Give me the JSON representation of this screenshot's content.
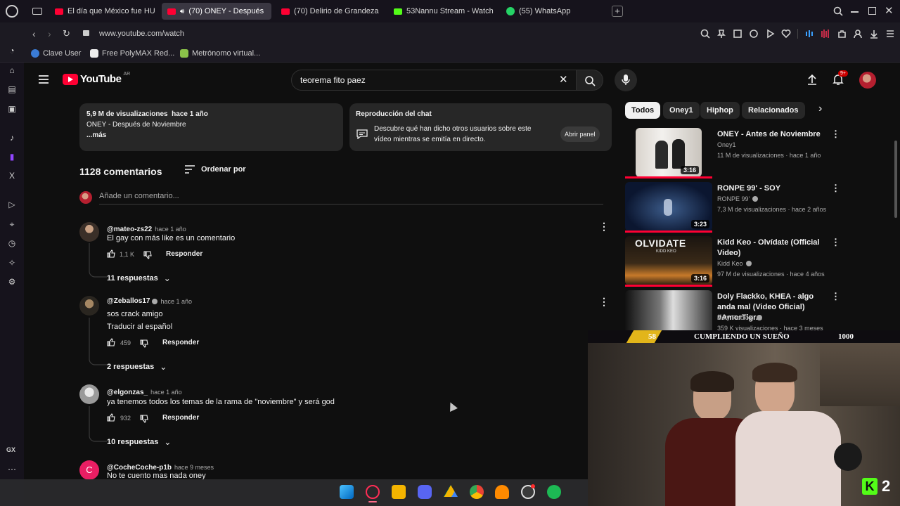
{
  "browser": {
    "tabs": [
      {
        "label": "El día que México fue HUM",
        "favicon": "youtube-icon",
        "active": false
      },
      {
        "label": "(70) ONEY - Después",
        "favicon": "youtube-icon",
        "active": true
      },
      {
        "label": "(70) Delirio de Grandeza",
        "favicon": "youtube-icon",
        "active": false
      },
      {
        "label": "53Nannu Stream - Watch",
        "favicon": "kick-icon",
        "active": false
      },
      {
        "label": "(55) WhatsApp",
        "favicon": "whatsapp-icon",
        "active": false
      }
    ],
    "url": "www.youtube.com/watch",
    "bookmarks": [
      {
        "label": "Clave User"
      },
      {
        "label": "Free PolyMAX Red..."
      },
      {
        "label": "Metrónomo virtual..."
      }
    ],
    "left_rail_label": "GX"
  },
  "youtube": {
    "logo_text": "YouTube",
    "country": "AR",
    "search_value": "teorema fito paez",
    "notif_badge": "9+"
  },
  "description": {
    "stats": "5,9 M de visualizaciones  hace 1 año",
    "line": "ONEY - Después de Noviembre",
    "more": "...más"
  },
  "chat_replay": {
    "title": "Reproducción del chat",
    "text_line1": "Descubre qué han dicho otros usuarios sobre este",
    "text_line2": "vídeo mientras se emitía en directo.",
    "button": "Abrir panel"
  },
  "comments_header": {
    "count": "1128 comentarios",
    "sort": "Ordenar por",
    "add_placeholder": "Añade un comentario..."
  },
  "comments": [
    {
      "handle": "@mateo-zs22",
      "time": "hace 1 año",
      "text": "El gay con más like es un comentario",
      "likes": "1,1 K",
      "reply": "Responder",
      "replies": "11 respuestas"
    },
    {
      "handle": "@Zeballos17",
      "time": "hace 1 año",
      "text": "sos crack amigo",
      "translate": "Traducir al español",
      "likes": "459",
      "reply": "Responder",
      "replies": "2 respuestas"
    },
    {
      "handle": "@elgonzas_",
      "time": "hace 1 año",
      "text": "ya tenemos todos los temas de la rama de \"noviembre\" y será god",
      "likes": "932",
      "reply": "Responder",
      "replies": "10 respuestas"
    },
    {
      "handle": "@CocheCoche-p1b",
      "time": "hace 9 meses",
      "text": "No te cuento mas nada oney",
      "avatar_letter": "C"
    }
  ],
  "chips": [
    "Todos",
    "Oney1",
    "Hiphop",
    "Relacionados"
  ],
  "recommendations": [
    {
      "title": "ONEY - Antes de Noviembre",
      "channel": "Oney1",
      "meta": "11 M de visualizaciones · hace 1 año",
      "duration": "3:16",
      "verified": false
    },
    {
      "title": "RONPE 99' - SOY",
      "channel": "RONPE 99'",
      "meta": "7,3 M de visualizaciones · hace 2 años",
      "duration": "3:23",
      "verified": true
    },
    {
      "title": "Kidd Keo - Olvídate (Official Video)",
      "channel": "Kidd Keo",
      "meta": "97 M de visualizaciones · hace 4 años",
      "duration": "3:16",
      "verified": true,
      "thumb_text": "OLVIDATE",
      "thumb_sub": "KIDD KEO"
    },
    {
      "title": "Doly Flackko, KHEA - algo anda mal (Video Oficial) #AmorTigr...",
      "channel": "Doly Flackko",
      "meta": "359 K visualizaciones · hace 3 meses",
      "verified": true
    }
  ],
  "webcam": {
    "left_num": "58",
    "banner": "CUMPLIENDO UN SUEÑO",
    "right_num": "1000",
    "kick_count": "2"
  },
  "colors": {
    "youtube_red": "#ff0033",
    "kick_green": "#53fc18",
    "bg": "#0f0f0f"
  }
}
